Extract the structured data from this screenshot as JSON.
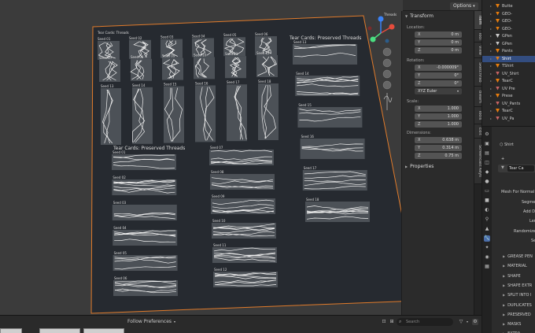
{
  "header": {
    "options_label": "Options"
  },
  "gizmo": {
    "thread_label": "Threads"
  },
  "sheet": {
    "title_top": "Tear Cards: Threads",
    "title_right": "Tear Cards: Preserved Threads",
    "title_bottom": "Tear Cards: Preserved Threads",
    "seeds_small": [
      "Seed 01",
      "Seed 02",
      "Seed 03",
      "Seed 04",
      "Seed 05",
      "Seed 06",
      "Seed 07",
      "Seed 08",
      "Seed 09",
      "Seed 10",
      "Seed 11",
      "Seed 12",
      "Seed 13",
      "Seed 14",
      "Seed 15",
      "Seed 16",
      "Seed 17",
      "Seed 18"
    ],
    "seeds_left": [
      "Seed 01",
      "Seed 02",
      "Seed 03",
      "Seed 04",
      "Seed 05",
      "Seed 06"
    ],
    "seeds_mid": [
      "Seed 07",
      "Seed 08",
      "Seed 09",
      "Seed 10",
      "Seed 11",
      "Seed 12"
    ],
    "seeds_right": [
      "Seed 13",
      "Seed 14",
      "Seed 15",
      "Seed 16",
      "Seed 17",
      "Seed 18"
    ],
    "seeds_far": [
      "Seed 13",
      "Seed 14",
      "Seed 15",
      "Seed 16"
    ]
  },
  "npanel": {
    "transform_header": "Transform",
    "location_label": "Location:",
    "location": [
      {
        "axis": "X",
        "value": "0 m"
      },
      {
        "axis": "Y",
        "value": "0 m"
      },
      {
        "axis": "Z",
        "value": "0 m"
      }
    ],
    "rotation_label": "Rotation:",
    "rotation": [
      {
        "axis": "X",
        "value": "-0.000009°"
      },
      {
        "axis": "Y",
        "value": "0°"
      },
      {
        "axis": "Z",
        "value": "0°"
      }
    ],
    "rotation_mode": "XYZ Euler",
    "scale_label": "Scale:",
    "scale": [
      {
        "axis": "X",
        "value": "1.000"
      },
      {
        "axis": "Y",
        "value": "1.000"
      },
      {
        "axis": "Z",
        "value": "1.000"
      }
    ],
    "dimensions_label": "Dimensions:",
    "dimensions": [
      {
        "axis": "X",
        "value": "0.638 m"
      },
      {
        "axis": "Y",
        "value": "0.314 m"
      },
      {
        "axis": "Z",
        "value": "0.75 m"
      }
    ],
    "properties_header": "Properties"
  },
  "vtabs": [
    "Item",
    "Tool",
    "View",
    "SketchFab",
    "Bleam",
    "Tools",
    "Edit",
    "Screencast Keys"
  ],
  "outliner": {
    "rows": [
      {
        "name": "Butte",
        "icon": "mesh"
      },
      {
        "name": "GEO-",
        "icon": "mesh"
      },
      {
        "name": "GEO-",
        "icon": "mesh"
      },
      {
        "name": "GEO-",
        "icon": "mesh"
      },
      {
        "name": "GPen",
        "icon": "gp"
      },
      {
        "name": "GPen",
        "icon": "gp"
      },
      {
        "name": "Pants",
        "icon": "mesh"
      },
      {
        "name": "Shirt",
        "icon": "mesh",
        "selected": true
      },
      {
        "name": "TShirt",
        "icon": "mesh"
      },
      {
        "name": "UV_Shirt",
        "icon": "uv"
      },
      {
        "name": "TearC",
        "icon": "mesh"
      },
      {
        "name": "UV Pre",
        "icon": "uv"
      },
      {
        "name": "Prese",
        "icon": "mesh"
      },
      {
        "name": "UV_Pants",
        "icon": "uv"
      },
      {
        "name": "TearC",
        "icon": "mesh"
      },
      {
        "name": "UV_Pa",
        "icon": "uv"
      }
    ]
  },
  "properties": {
    "breadcrumb": "Shirt",
    "modifier_name": "Tear Ca",
    "fields": [
      "Mesh For Normal",
      "Segme",
      "Add Divisi",
      "Len",
      "Randomize Len",
      "Se"
    ],
    "sections": [
      "GREASE PEN",
      "MATERIAL",
      "SHAPE",
      "SHAPE EXTR",
      "SPLIT INTO I",
      "DUPLICATES",
      "PRESERVED",
      "MASKS",
      "EXTRA"
    ]
  },
  "bottombar": {
    "follow_label": "Follow Preferences",
    "search_placeholder": "Search"
  }
}
